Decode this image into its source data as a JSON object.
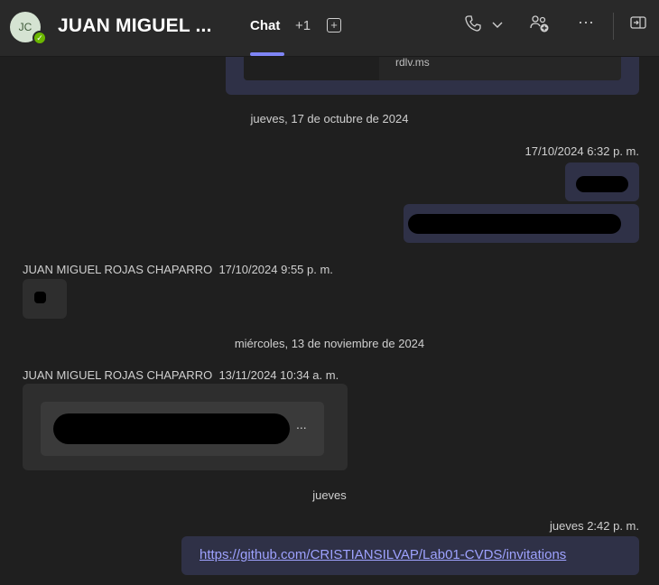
{
  "header": {
    "avatar_initials": "JC",
    "title": "JUAN MIGUEL ...",
    "tab_chat": "Chat",
    "tab_more": "+1",
    "icons": [
      "phone-icon",
      "chevron-down-icon",
      "add-people-icon",
      "more-options-icon",
      "popout-icon"
    ]
  },
  "messages": {
    "top_attachment_name": "rdlv.ms",
    "date_1": "jueves, 17 de octubre de 2024",
    "me_ts_1": "17/10/2024 6:32 p. m.",
    "other_name_1": "JUAN MIGUEL ROJAS CHAPARRO",
    "other_ts_1": "17/10/2024 9:55 p. m.",
    "date_2": "miércoles, 13 de noviembre de 2024",
    "other_name_2": "JUAN MIGUEL ROJAS CHAPARRO",
    "other_ts_2": "13/11/2024 10:34 a. m.",
    "ellipsis": "...",
    "date_3": "jueves",
    "me_ts_2": "jueves 2:42 p. m.",
    "link_text": "https://github.com/CRISTIANSILVAP/Lab01-CVDS/invitations"
  },
  "colors": {
    "accent": "#7f85f5",
    "my_bubble": "#2f3147",
    "other_bubble": "#2e2e2e",
    "presence": "#6bb700"
  }
}
